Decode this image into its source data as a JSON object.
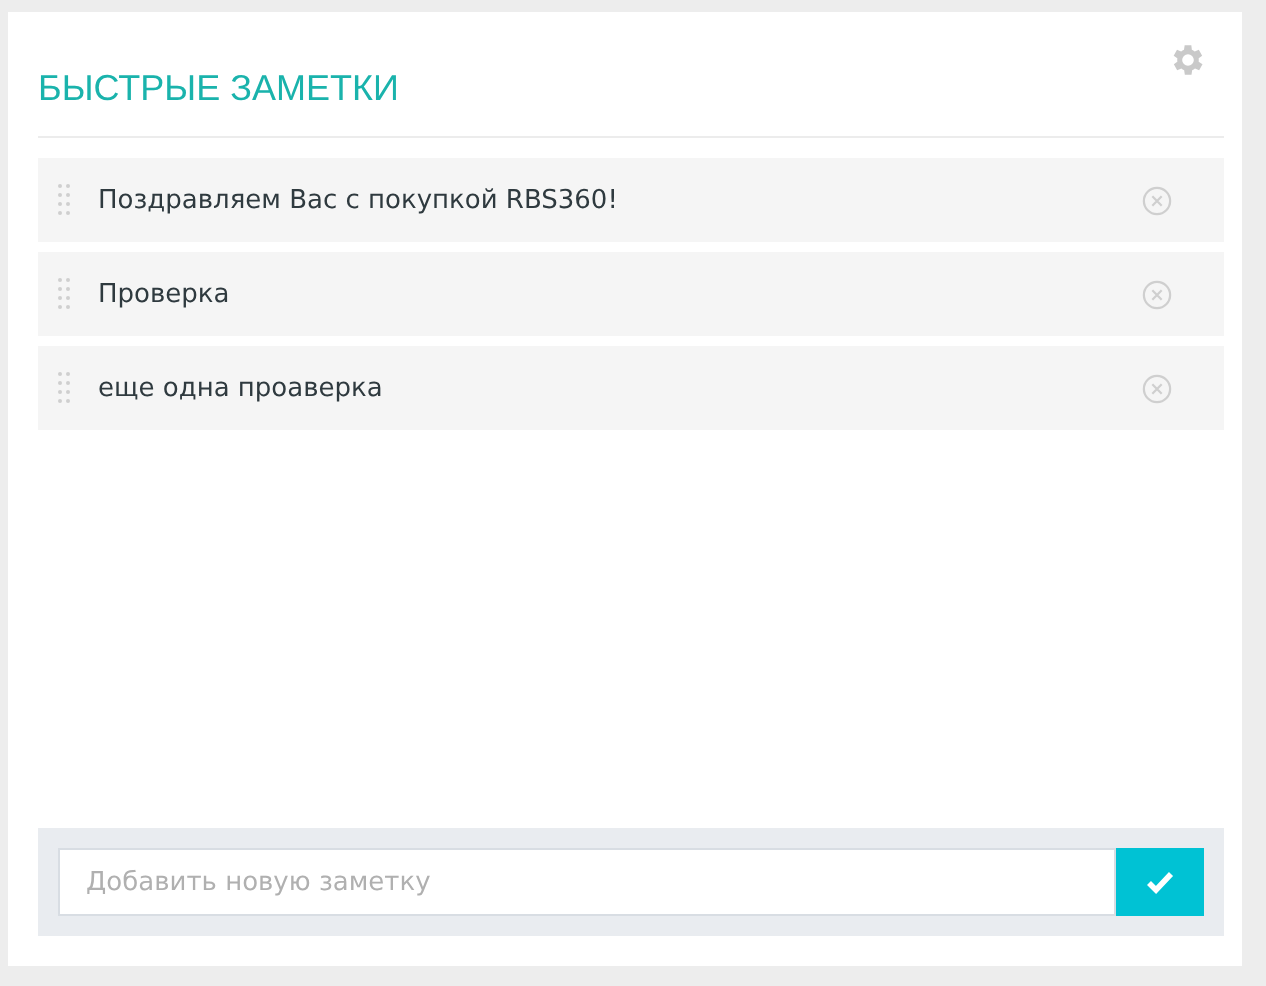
{
  "panel": {
    "title": "БЫСТРЫЕ ЗАМЕТКИ"
  },
  "notes": [
    {
      "text": "Поздравляем Вас с покупкой RBS360!"
    },
    {
      "text": "Проверка"
    },
    {
      "text": "еще одна проаверка"
    }
  ],
  "new_note": {
    "placeholder": "Добавить новую заметку"
  }
}
